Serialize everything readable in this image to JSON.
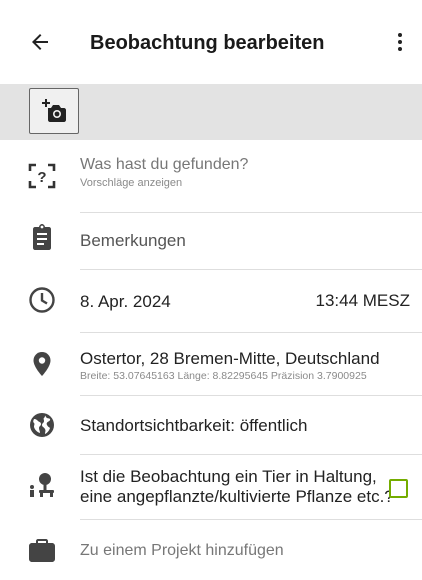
{
  "header": {
    "title": "Beobachtung bearbeiten",
    "back_icon": "arrow-back-icon",
    "menu_icon": "more-vert-icon"
  },
  "photos": {
    "add_icon": "add-photo-icon"
  },
  "species": {
    "label": "Was hast du gefunden?",
    "sub": "Vorschläge anzeigen",
    "icon": "species-suggest-icon"
  },
  "notes": {
    "label": "Bemerkungen",
    "icon": "clipboard-icon"
  },
  "datetime": {
    "date": "8. Apr. 2024",
    "time": "13:44 MESZ",
    "icon": "clock-icon"
  },
  "location": {
    "place": "Ostertor, 28 Bremen-Mitte, Deutschland",
    "details": "Breite: 53.07645163 Länge: 8.82295645 Präzision 3.7900925",
    "icon": "location-pin-icon"
  },
  "geoprivacy": {
    "label": "Standortsichtbarkeit: öffentlich",
    "icon": "globe-icon"
  },
  "captive": {
    "line1": "Ist die Beobachtung ein Tier in Haltung,",
    "line2": "eine angepflanzte/kultivierte Pflanze etc.?",
    "icon": "captive-icon",
    "checked": false
  },
  "project": {
    "label": "Zu einem Projekt hinzufügen",
    "icon": "briefcase-icon"
  },
  "colors": {
    "accent": "#74ac00",
    "icon": "#4a4a4a",
    "strip": "#e3e3e3"
  }
}
